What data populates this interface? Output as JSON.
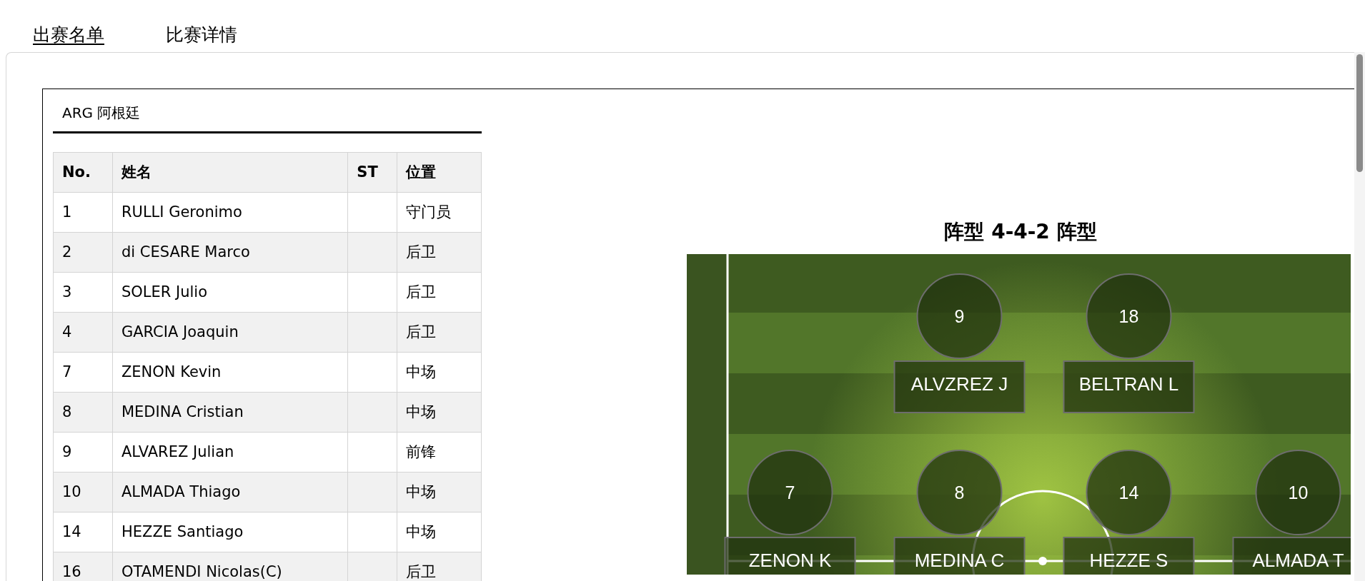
{
  "tabs": [
    {
      "label": "出赛名单",
      "selected": true
    },
    {
      "label": "比赛详情",
      "selected": false
    }
  ],
  "team": {
    "label": "ARG 阿根廷"
  },
  "table": {
    "columns": [
      "No.",
      "姓名",
      "ST",
      "位置"
    ],
    "rows": [
      [
        "1",
        "RULLI Geronimo",
        "",
        "守门员"
      ],
      [
        "2",
        "di CESARE Marco",
        "",
        "后卫"
      ],
      [
        "3",
        "SOLER Julio",
        "",
        "后卫"
      ],
      [
        "4",
        "GARCIA Joaquin",
        "",
        "后卫"
      ],
      [
        "7",
        "ZENON Kevin",
        "",
        "中场"
      ],
      [
        "8",
        "MEDINA Cristian",
        "",
        "中场"
      ],
      [
        "9",
        "ALVAREZ Julian",
        "",
        "前锋"
      ],
      [
        "10",
        "ALMADA Thiago",
        "",
        "中场"
      ],
      [
        "14",
        "HEZZE Santiago",
        "",
        "中场"
      ],
      [
        "16",
        "OTAMENDI Nicolas(C)",
        "",
        "后卫"
      ]
    ]
  },
  "formation": {
    "title": "阵型 4-4-2 阵型",
    "lines": [
      {
        "players": [
          {
            "number": "9",
            "label": "ALVZREZ J"
          },
          {
            "number": "18",
            "label": "BELTRAN L"
          }
        ]
      },
      {
        "players": [
          {
            "number": "7",
            "label": "ZENON K"
          },
          {
            "number": "8",
            "label": "MEDINA C"
          },
          {
            "number": "14",
            "label": "HEZZE S"
          },
          {
            "number": "10",
            "label": "ALMADA T"
          }
        ]
      }
    ]
  }
}
